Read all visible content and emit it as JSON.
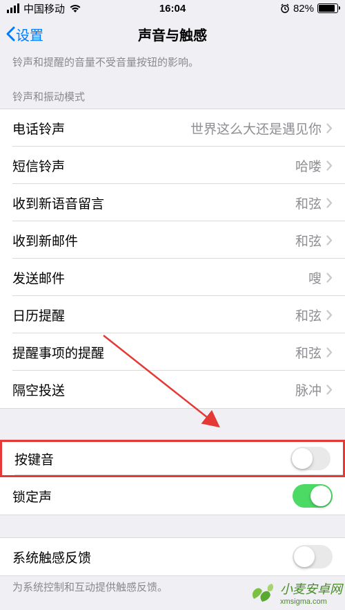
{
  "status": {
    "carrier": "中国移动",
    "time": "16:04",
    "battery_pct": "82%"
  },
  "nav": {
    "back": "设置",
    "title": "声音与触感"
  },
  "hint_top": "铃声和提醒的音量不受音量按钮的影响。",
  "section_ringtone": "铃声和振动模式",
  "rows": {
    "ringtone": {
      "label": "电话铃声",
      "value": "世界这么大还是遇见你"
    },
    "text_tone": {
      "label": "短信铃声",
      "value": "哈喽"
    },
    "voicemail": {
      "label": "收到新语音留言",
      "value": "和弦"
    },
    "new_mail": {
      "label": "收到新邮件",
      "value": "和弦"
    },
    "sent_mail": {
      "label": "发送邮件",
      "value": "嗖"
    },
    "calendar": {
      "label": "日历提醒",
      "value": "和弦"
    },
    "reminder": {
      "label": "提醒事项的提醒",
      "value": "和弦"
    },
    "airdrop": {
      "label": "隔空投送",
      "value": "脉冲"
    }
  },
  "toggles": {
    "keyboard_clicks": {
      "label": "按键音",
      "on": false
    },
    "lock_sound": {
      "label": "锁定声",
      "on": true
    }
  },
  "haptics": {
    "label": "系统触感反馈",
    "on": false
  },
  "hint_bottom": "为系统控制和互动提供触感反馈。",
  "watermark": {
    "text": "小麦安卓网",
    "url": "xmsigma.com"
  },
  "annotation": {
    "arrow_color": "#e53935"
  }
}
